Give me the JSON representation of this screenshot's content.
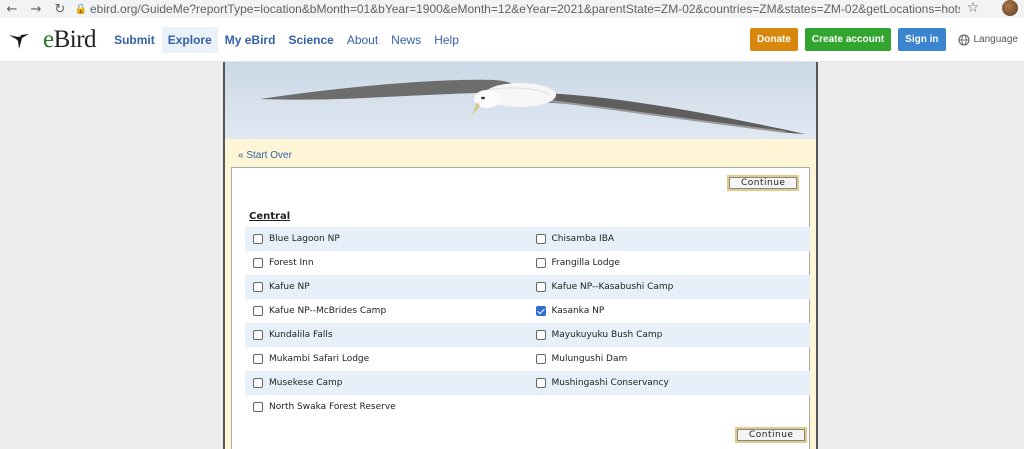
{
  "browser": {
    "url": "ebird.org/GuideMe?reportType=location&bMonth=01&bYear=1900&eMonth=12&eYear=2021&parentState=ZM-02&countries=ZM&states=ZM-02&getLocations=hotspots&co..."
  },
  "header": {
    "logo_e": "e",
    "logo_rest": "Bird",
    "nav": [
      "Submit",
      "Explore",
      "My eBird",
      "Science",
      "About",
      "News",
      "Help"
    ],
    "donate": "Donate",
    "create_account": "Create account",
    "sign_in": "Sign in",
    "language": "Language"
  },
  "page": {
    "start_over": "« Start Over",
    "continue": "Continue",
    "region": "Central",
    "rows": [
      [
        {
          "label": "Blue Lagoon NP",
          "checked": false
        },
        {
          "label": "Chisamba IBA",
          "checked": false
        }
      ],
      [
        {
          "label": "Forest Inn",
          "checked": false
        },
        {
          "label": "Frangilla Lodge",
          "checked": false
        }
      ],
      [
        {
          "label": "Kafue NP",
          "checked": false
        },
        {
          "label": "Kafue NP--Kasabushi Camp",
          "checked": false
        }
      ],
      [
        {
          "label": "Kafue NP--McBrides Camp",
          "checked": false
        },
        {
          "label": "Kasanka NP",
          "checked": true
        }
      ],
      [
        {
          "label": "Kundalila Falls",
          "checked": false
        },
        {
          "label": "Mayukuyuku Bush Camp",
          "checked": false
        }
      ],
      [
        {
          "label": "Mukambi Safari Lodge",
          "checked": false
        },
        {
          "label": "Mulungushi Dam",
          "checked": false
        }
      ],
      [
        {
          "label": "Musekese Camp",
          "checked": false
        },
        {
          "label": "Mushingashi Conservancy",
          "checked": false
        }
      ],
      [
        {
          "label": "North Swaka Forest Reserve",
          "checked": false
        }
      ]
    ]
  }
}
